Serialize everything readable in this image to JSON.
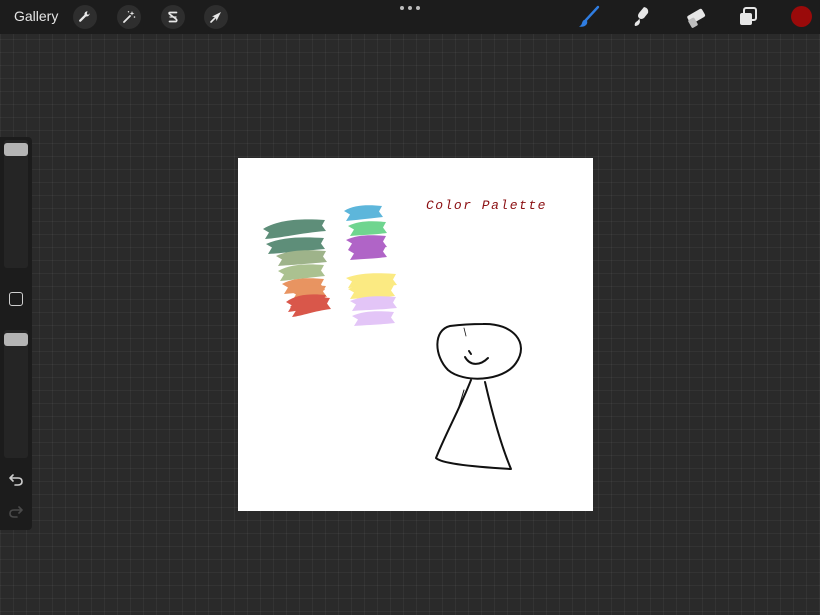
{
  "toolbar": {
    "gallery_label": "Gallery",
    "left_tools": [
      {
        "name": "actions",
        "icon": "wrench-icon"
      },
      {
        "name": "adjustments",
        "icon": "magic-wand-icon"
      },
      {
        "name": "selection",
        "icon": "selection-s-icon"
      },
      {
        "name": "transform",
        "icon": "arrow-cursor-icon"
      }
    ],
    "right_tools": [
      {
        "name": "brush",
        "icon": "brush-icon",
        "active": true
      },
      {
        "name": "smudge",
        "icon": "smudge-icon",
        "active": false
      },
      {
        "name": "eraser",
        "icon": "eraser-icon",
        "active": false
      },
      {
        "name": "layers",
        "icon": "layers-icon",
        "active": false
      }
    ],
    "current_color": "#9a0a0a",
    "active_tool_color": "#2f7de1"
  },
  "sidebar": {
    "brush_size_level": 0.97,
    "opacity_level": 0.97,
    "undo_icon": "undo-icon",
    "redo_icon": "redo-icon"
  },
  "canvas": {
    "title_text": "Color Palette",
    "title_color": "#8b0f12",
    "swatches_left": [
      "#5e8e79",
      "#9eb38a",
      "#abc190",
      "#e89461",
      "#d9574a"
    ],
    "swatches_right": [
      "#5db6db",
      "#6fd58f",
      "#b064c7",
      "#fbea82",
      "#e3c5f7"
    ],
    "stroke_color": "#111111"
  }
}
